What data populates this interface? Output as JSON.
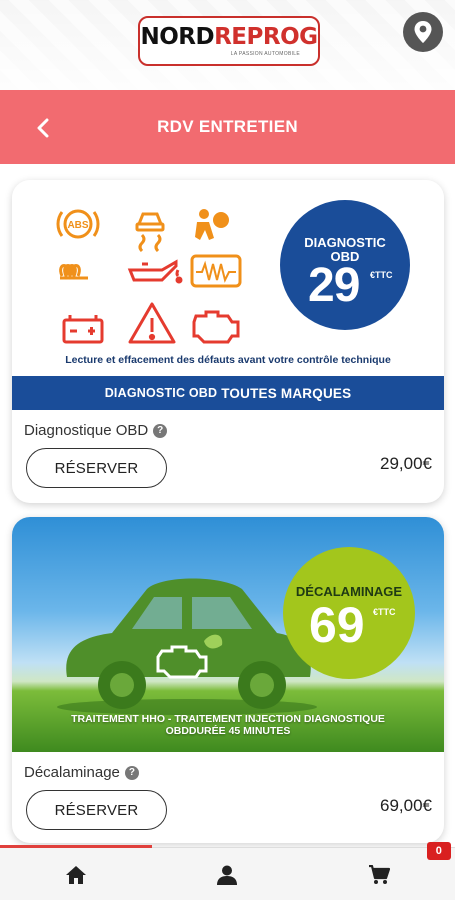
{
  "brand": {
    "logo_nord": "NORD",
    "logo_reprog": "REPROG",
    "tagline": "La passion automobile"
  },
  "header": {
    "title": "RDV ENTRETIEN"
  },
  "products": [
    {
      "banner": {
        "circle_title_line1": "DIAGNOSTIC",
        "circle_title_line2": "OBD",
        "circle_price": "29",
        "circle_unit": "€TTC",
        "caption": "Lecture et effacement des défauts avant votre contrôle technique",
        "strip_small": "DIAGNOSTIC OBD",
        "strip_big": "TOUTES MARQUES"
      },
      "name": "Diagnostique OBD",
      "reserve_label": "RÉSERVER",
      "price": "29,00€"
    },
    {
      "banner": {
        "circle_title": "DÉCALAMINAGE",
        "circle_price": "69",
        "circle_unit": "€TTC",
        "caption_line1": "TRAITEMENT HHO - TRAITEMENT INJECTION DIAGNOSTIQUE",
        "caption_line2": "OBDDURÉE 45 MINUTES"
      },
      "name": "Décalaminage",
      "reserve_label": "RÉSERVER",
      "price": "69,00€"
    }
  ],
  "nav": {
    "active": "home",
    "cart_count": "0"
  },
  "colors": {
    "header": "#f26b70",
    "obd_blue": "#1a4d99",
    "deca_green": "#a3c61c",
    "warning_orange": "#f0901a",
    "warning_red": "#e53b2f",
    "badge_red": "#d92020"
  }
}
